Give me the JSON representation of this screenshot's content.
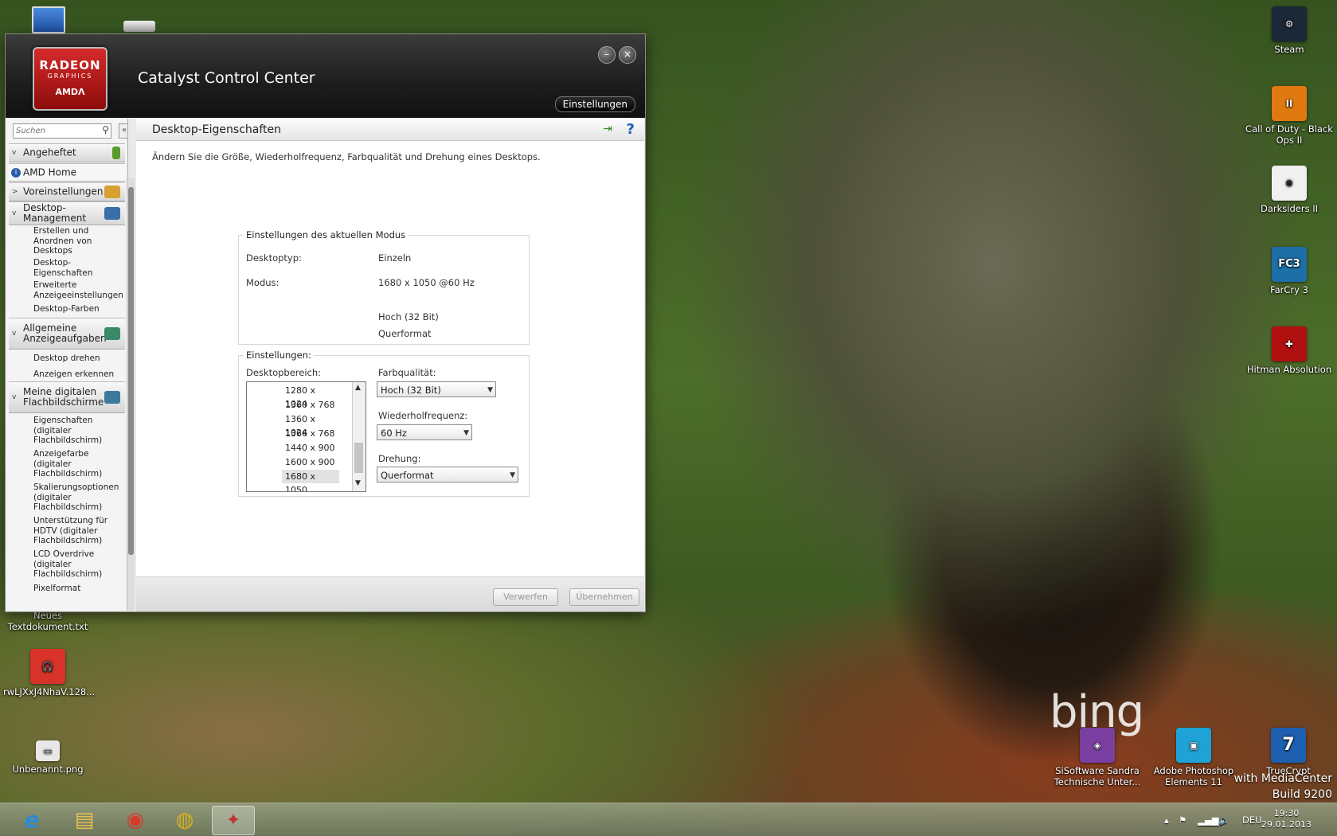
{
  "desktop": {
    "icons_right": [
      {
        "label": "Steam",
        "color": "#1b2838",
        "glyph": "⚙"
      },
      {
        "label": "Call of Duty - Black Ops II",
        "color": "#e07a10",
        "glyph": "II"
      },
      {
        "label": "Darksiders II",
        "color": "#f0f0f0",
        "glyph": "✺"
      },
      {
        "label": "FarCry 3",
        "color": "#1d6fa8",
        "glyph": "FC3"
      },
      {
        "label": "Hitman Absolution",
        "color": "#b01010",
        "glyph": "✚"
      }
    ],
    "icons_left": [
      {
        "label": "Neues Textdokument.txt"
      },
      {
        "label": "rwLJXxJ4NhaV.128...",
        "color": "#d8322a",
        "glyph": "🎧"
      },
      {
        "label": "Unbenannt.png",
        "color": "#e8e8e8",
        "glyph": "▭"
      }
    ],
    "icons_bottom": [
      {
        "label": "SiSoftware Sandra Technische Unter...",
        "color": "#7a3fa0",
        "glyph": "◈"
      },
      {
        "label": "Adobe Photoshop Elements 11",
        "color": "#1fa3d6",
        "glyph": "▣"
      },
      {
        "label": "TrueCrypt",
        "color": "#1f5fb0",
        "glyph": "7"
      }
    ],
    "bing_text": "bing",
    "watermark_line1": "with MediaCenter",
    "watermark_line2": "Build 9200"
  },
  "window": {
    "logo_line1": "RADEON",
    "logo_line2": "GRAPHICS",
    "logo_line3": "AMDΛ",
    "title": "Catalyst Control Center",
    "minimize_glyph": "–",
    "close_glyph": "×",
    "settings_label": "Einstellungen"
  },
  "sidebar": {
    "search_placeholder": "Suchen",
    "collapse_glyph": "«",
    "sections": [
      {
        "label": "Angeheftet",
        "arrow": "v",
        "icon_color": "#5a9c2a"
      },
      {
        "label": "AMD Home",
        "arrow": "i",
        "icon_color": ""
      },
      {
        "label": "Voreinstellungen",
        "arrow": ">",
        "icon_color": "#d8a030"
      },
      {
        "label": "Desktop-Management",
        "arrow": "v",
        "icon_color": "#3a6ea8"
      },
      {
        "label": "Allgemeine Anzeigeaufgaben",
        "arrow": "v",
        "icon_color": "#3a8a6a"
      },
      {
        "label": "Meine digitalen Flachbildschirme",
        "arrow": "v",
        "icon_color": "#3a7a9a"
      }
    ],
    "desktop_mgmt_items": [
      "Erstellen und Anordnen von Desktops",
      "Desktop-Eigenschaften",
      "Erweiterte Anzeigeeinstellungen",
      "Desktop-Farben"
    ],
    "display_task_items": [
      "Desktop drehen",
      "Anzeigen erkennen"
    ],
    "flatpanel_items": [
      "Eigenschaften (digitaler Flachbildschirm)",
      "Anzeigefarbe (digitaler Flachbildschirm)",
      "Skalierungsoptionen (digitaler Flachbildschirm)",
      "Unterstützung für HDTV (digitaler Flachbildschirm)",
      "LCD Overdrive (digitaler Flachbildschirm)",
      "Pixelformat"
    ]
  },
  "content": {
    "title": "Desktop-Eigenschaften",
    "pin_glyph": "⇥",
    "help_glyph": "?",
    "description": "Ändern Sie die Größe, Wiederholfrequenz, Farbqualität und Drehung eines Desktops.",
    "current_mode": {
      "title": "Einstellungen des aktuellen Modus",
      "desktop_type_label": "Desktoptyp:",
      "desktop_type_value": "Einzeln",
      "mode_label": "Modus:",
      "mode_value": "1680 x 1050 @60 Hz",
      "color_value": "Hoch (32 Bit)",
      "orientation_value": "Querformat"
    },
    "settings": {
      "title": "Einstellungen:",
      "desktop_area_label": "Desktopbereich:",
      "resolutions": [
        "1280 x 1024",
        "1360 x  768",
        "1360 x 1024",
        "1366 x  768",
        "1440 x  900",
        "1600 x  900",
        "1680 x 1050"
      ],
      "selected_resolution": "1680 x 1050",
      "color_quality_label": "Farbqualität:",
      "color_quality_value": "Hoch (32 Bit)",
      "refresh_label": "Wiederholfrequenz:",
      "refresh_value": "60 Hz",
      "rotation_label": "Drehung:",
      "rotation_value": "Querformat"
    },
    "discard_label": "Verwerfen",
    "apply_label": "Übernehmen"
  },
  "taskbar": {
    "apps": [
      {
        "name": "internet-explorer",
        "glyph": "e",
        "color": "#2a8ad8"
      },
      {
        "name": "file-explorer",
        "glyph": "▤",
        "color": "#e8c050"
      },
      {
        "name": "chrome",
        "glyph": "◉",
        "color": "#d83a2a"
      },
      {
        "name": "world-app",
        "glyph": "◍",
        "color": "#d8b020"
      },
      {
        "name": "catalyst",
        "glyph": "✦",
        "color": "#c03030"
      }
    ],
    "language": "DEU",
    "time": "19:30",
    "date": "29.01.2013"
  }
}
